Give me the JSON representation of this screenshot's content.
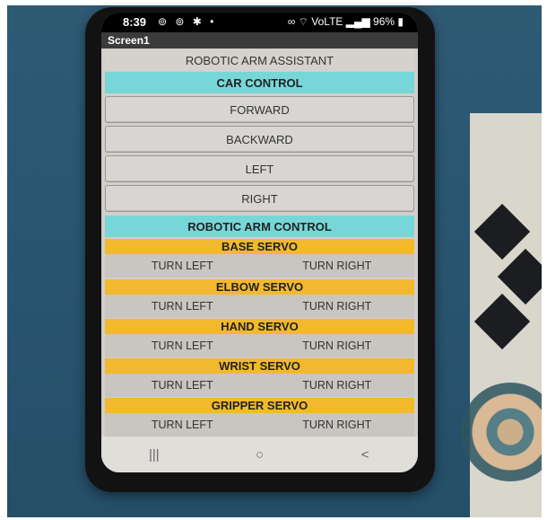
{
  "status": {
    "time": "8:39",
    "left_icons": "⊚ ⊚ ✱ •",
    "right_icons": "∞ ⌔ VoLTE ▂▄▆ 96% ▮"
  },
  "app": {
    "screen_title": "Screen1"
  },
  "header": {
    "assistant_label": "ROBOTIC ARM ASSISTANT"
  },
  "car": {
    "section_label": "CAR CONTROL",
    "forward_label": "FORWARD",
    "backward_label": "BACKWARD",
    "left_label": "LEFT",
    "right_label": "RIGHT"
  },
  "arm": {
    "section_label": "ROBOTIC ARM CONTROL",
    "servos": [
      {
        "label": "BASE SERVO",
        "turn_left": "TURN LEFT",
        "turn_right": "TURN RIGHT"
      },
      {
        "label": "ELBOW SERVO",
        "turn_left": "TURN LEFT",
        "turn_right": "TURN RIGHT"
      },
      {
        "label": "HAND SERVO",
        "turn_left": "TURN LEFT",
        "turn_right": "TURN RIGHT"
      },
      {
        "label": "WRIST SERVO",
        "turn_left": "TURN LEFT",
        "turn_right": "TURN RIGHT"
      },
      {
        "label": "GRIPPER SERVO",
        "turn_left": "TURN LEFT",
        "turn_right": "TURN RIGHT"
      }
    ]
  },
  "navbar": {
    "recents": "|||",
    "home": "○",
    "back": "<"
  },
  "colors": {
    "section_cyan": "#76d6d8",
    "servo_header": "#f2b92e",
    "button_bg": "#d8d6d2"
  }
}
